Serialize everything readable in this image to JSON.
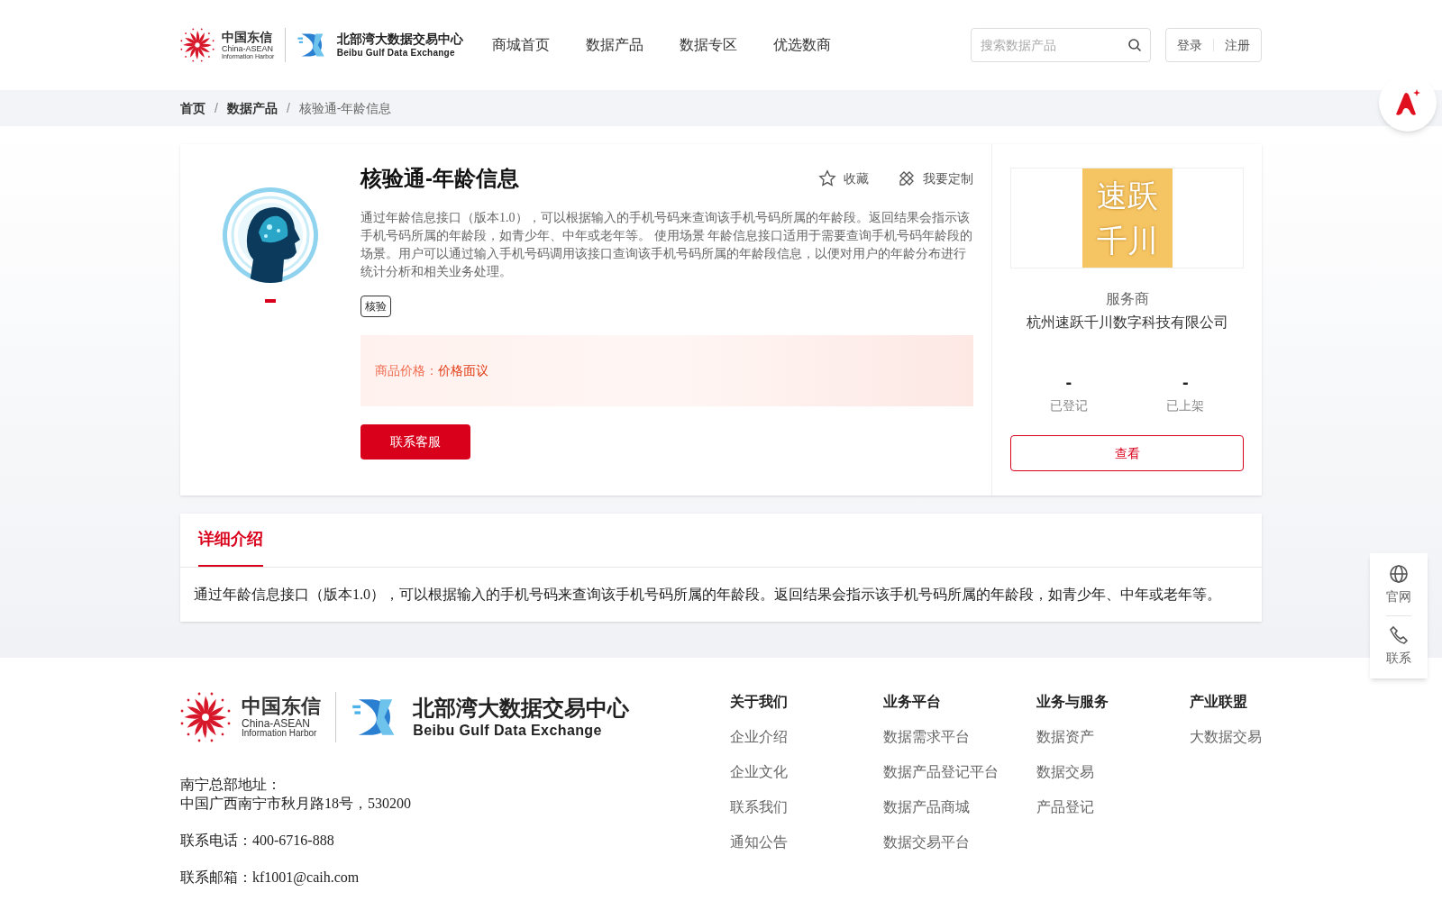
{
  "header": {
    "logo": {
      "cn": "中国东信",
      "en1": "China-ASEAN",
      "en2": "Information Harbor",
      "exchange_cn": "北部湾大数据交易中心",
      "exchange_en": "Beibu Gulf Data Exchange"
    },
    "nav": [
      {
        "label": "商城首页",
        "selected": false
      },
      {
        "label": "数据产品",
        "selected": false
      },
      {
        "label": "数据专区",
        "selected": false
      },
      {
        "label": "优选数商",
        "selected": false
      }
    ],
    "search": {
      "placeholder": "搜索数据产品"
    },
    "auth": [
      "登录",
      "注册"
    ]
  },
  "breadcrumb": {
    "items": [
      "首页",
      "数据产品",
      "核验通-年龄信息"
    ],
    "separators": [
      "/",
      "/"
    ]
  },
  "product": {
    "title": "核验通-年龄信息",
    "actions": [
      {
        "kind": "star",
        "label": "收藏"
      },
      {
        "kind": "custom",
        "label": "我要定制"
      }
    ],
    "description": "通过年龄信息接口（版本1.0），可以根据输入的手机号码来查询该手机号码所属的年龄段。返回结果会指示该手机号码所属的年龄段，如青少年、中年或老年等。 使用场景 年龄信息接口适用于需要查询手机号码年龄段的场景。用户可以通过输入手机号码调用该接口查询该手机号码所属的年龄段信息，以便对用户的年龄分布进行统计分析和相关业务处理。",
    "tags": [
      "核验"
    ],
    "price_label": "商品价格：",
    "price": "价格面议",
    "contact_button": "联系客服"
  },
  "provider": {
    "logo_lines": [
      "速跃",
      "千川"
    ],
    "role": "服务商",
    "name": "杭州速跃千川数字科技有限公司",
    "stats": [
      {
        "value": "-",
        "label": "已登记"
      },
      {
        "value": "-",
        "label": "已上架"
      }
    ],
    "view_button": "查看"
  },
  "detail": {
    "tabs": [
      {
        "label": "详细介绍",
        "selected": true
      }
    ],
    "text": "通过年龄信息接口（版本1.0），可以根据输入的手机号码来查询该手机号码所属的年龄段。返回结果会指示该手机号码所属的年龄段，如青少年、中年或老年等。"
  },
  "footer": {
    "logo": {
      "cn": "中国东信",
      "en1": "China-ASEAN",
      "en2": "Information Harbor",
      "exchange_cn": "北部湾大数据交易中心",
      "exchange_en": "Beibu Gulf Data Exchange"
    },
    "address_label": "南宁总部地址：",
    "address": "中国广西南宁市秋月路18号，530200",
    "phone": "联系电话：400-6716-888",
    "email": "联系邮箱：kf1001@caih.com",
    "columns": [
      {
        "title": "关于我们",
        "links": [
          "企业介绍",
          "企业文化",
          "联系我们",
          "通知公告"
        ]
      },
      {
        "title": "业务平台",
        "links": [
          "数据需求平台",
          "数据产品登记平台",
          "数据产品商城",
          "数据交易平台"
        ]
      },
      {
        "title": "业务与服务",
        "links": [
          "数据资产",
          "数据交易",
          "产品登记"
        ]
      },
      {
        "title": "产业联盟",
        "links": [
          "大数据交易"
        ]
      }
    ]
  },
  "float_tools": [
    {
      "kind": "globe",
      "label": "官网"
    },
    {
      "kind": "phone",
      "label": "联系"
    }
  ]
}
